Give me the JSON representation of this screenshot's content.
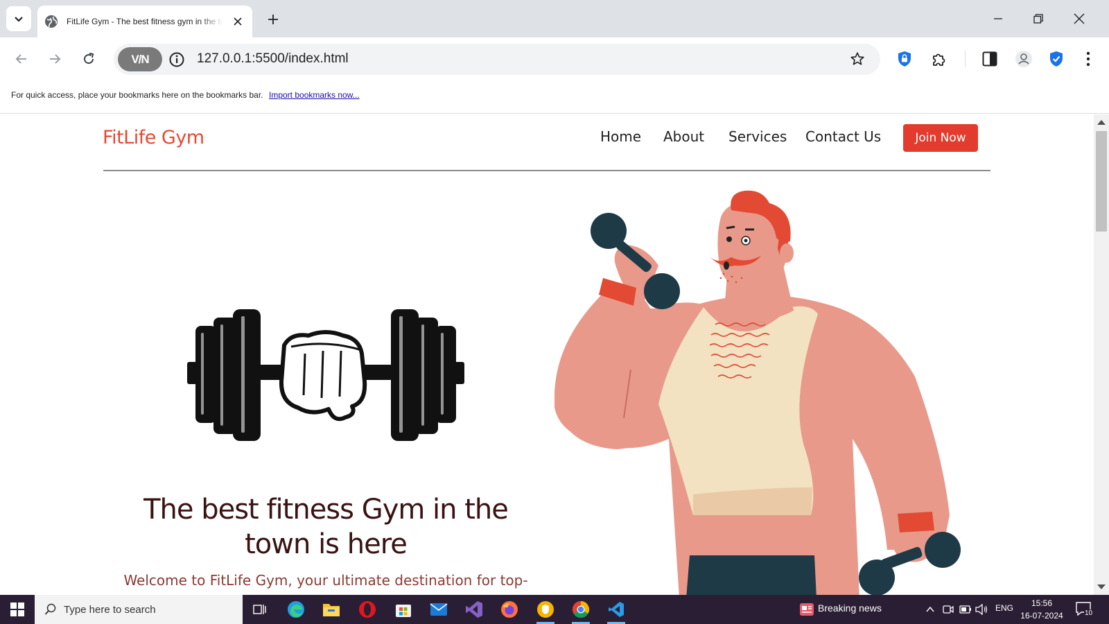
{
  "browser": {
    "tab_title": "FitLife Gym - The best fitness gym in the town",
    "url": "127.0.0.1:5500/index.html",
    "vpn_label": "V/N",
    "bookmarks_message": "For quick access, place your bookmarks here on the bookmarks bar.",
    "bookmarks_link": "Import bookmarks now..."
  },
  "site": {
    "logo": "FitLife Gym",
    "nav": [
      "Home",
      "About",
      "Services",
      "Contact Us"
    ],
    "cta": "Join Now",
    "headline": "The best fitness Gym in the town is here",
    "subline": "Welcome to FitLife Gym, your ultimate destination for top-"
  },
  "taskbar": {
    "search_placeholder": "Type here to search",
    "news": "Breaking news",
    "language": "ENG",
    "time": "15:56",
    "date": "16-07-2024",
    "notifications": "10"
  },
  "colors": {
    "brand": "#e24a33",
    "button": "#e33b2e",
    "headline": "#3a1212",
    "skin": "#e8998a",
    "tank_top": "#f2e2c2",
    "dumbbell": "#1e3a46",
    "taskbar": "#2a1e34"
  }
}
